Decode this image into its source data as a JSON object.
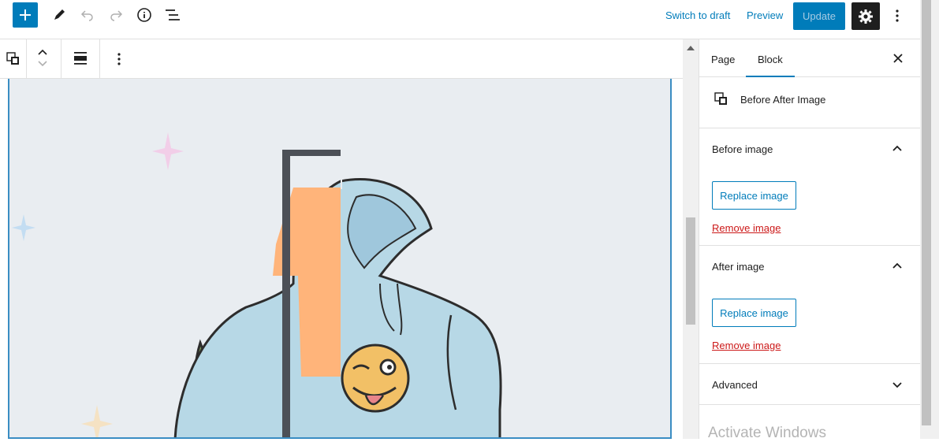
{
  "topbar": {
    "switch_to_draft": "Switch to draft",
    "preview": "Preview",
    "update": "Update",
    "icons": [
      "plus-icon",
      "pencil-icon",
      "undo-icon",
      "redo-icon",
      "info-icon",
      "list-view-icon",
      "gear-icon",
      "more-vertical-icon"
    ]
  },
  "block_toolbar": {
    "icons": [
      "before-after-block-icon",
      "move-up-icon",
      "move-down-icon",
      "align-icon",
      "more-options-icon"
    ]
  },
  "sidebar": {
    "tabs": [
      {
        "label": "Page"
      },
      {
        "label": "Block"
      }
    ],
    "active_tab": "Block",
    "block_card": {
      "title": "Before After Image"
    },
    "sections": [
      {
        "title": "Before image",
        "replace": "Replace image",
        "remove": "Remove image",
        "expanded": true
      },
      {
        "title": "After image",
        "replace": "Replace image",
        "remove": "Remove image",
        "expanded": true
      },
      {
        "title": "Advanced",
        "expanded": false
      }
    ]
  },
  "watermark": "Activate Windows",
  "colors": {
    "accent": "#007cba",
    "danger": "#cc1818",
    "canvas": "#e9edf1"
  }
}
